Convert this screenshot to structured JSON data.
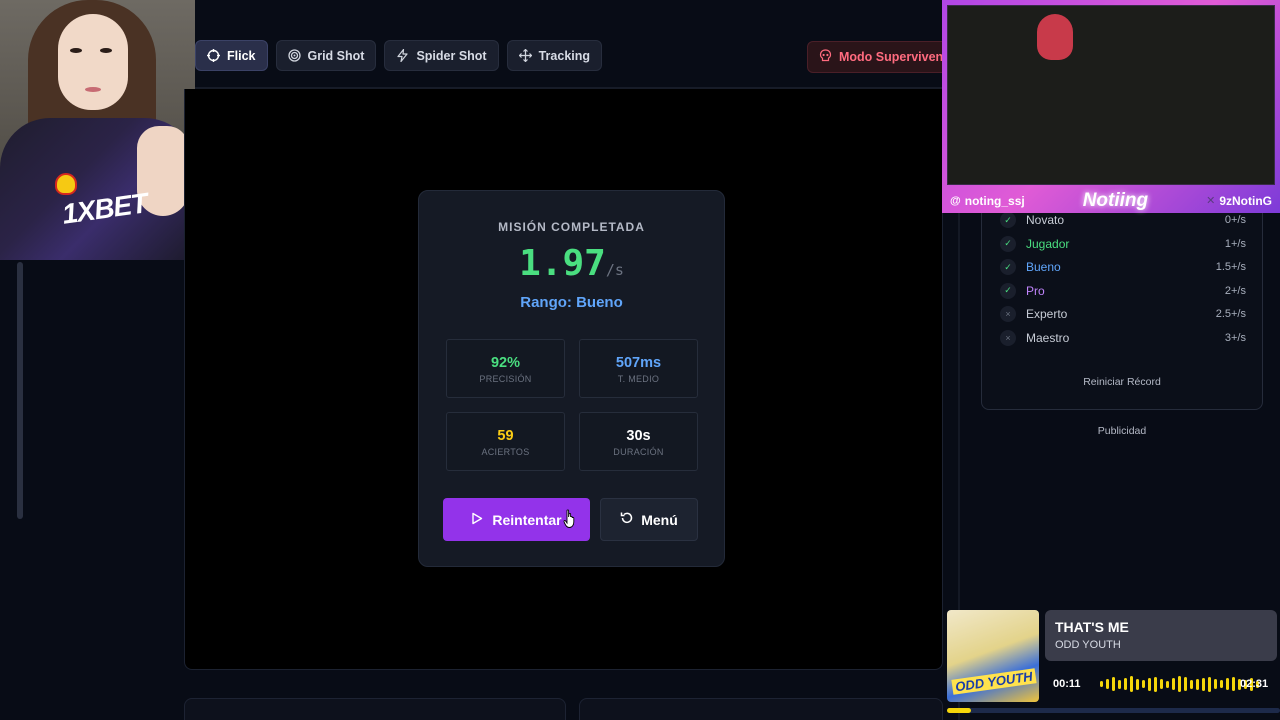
{
  "tabs": [
    {
      "label": "Flick",
      "icon": "crosshair-icon",
      "active": true
    },
    {
      "label": "Grid Shot",
      "icon": "target-icon",
      "active": false
    },
    {
      "label": "Spider Shot",
      "icon": "bolt-icon",
      "active": false
    },
    {
      "label": "Tracking",
      "icon": "move-icon",
      "active": false
    }
  ],
  "survival_mode": {
    "label": "Modo Supervivencia",
    "icon": "skull-icon"
  },
  "result": {
    "heading": "MISIÓN COMPLETADA",
    "score": "1.97",
    "score_unit": "/s",
    "rank": "Rango: Bueno",
    "stats": [
      {
        "value": "92%",
        "label": "PRECISIÓN",
        "color": "#4ade80"
      },
      {
        "value": "507ms",
        "label": "T. MEDIO",
        "color": "#60a5fa"
      },
      {
        "value": "59",
        "label": "ACIERTOS",
        "color": "#facc15"
      },
      {
        "value": "30s",
        "label": "DURACIÓN",
        "color": "#ffffff"
      }
    ],
    "retry_label": "Reintentar",
    "menu_label": "Menú"
  },
  "ranks": {
    "items": [
      {
        "name": "Novato",
        "rate": "0+/s",
        "achieved": true,
        "color": "#c7ccd6"
      },
      {
        "name": "Jugador",
        "rate": "1+/s",
        "achieved": true,
        "color": "#4ade80"
      },
      {
        "name": "Bueno",
        "rate": "1.5+/s",
        "achieved": true,
        "color": "#60a5fa"
      },
      {
        "name": "Pro",
        "rate": "2+/s",
        "achieved": true,
        "color": "#c084fc"
      },
      {
        "name": "Experto",
        "rate": "2.5+/s",
        "achieved": false,
        "color": "#c7ccd6"
      },
      {
        "name": "Maestro",
        "rate": "3+/s",
        "achieved": false,
        "color": "#c7ccd6"
      }
    ],
    "reset_label": "Reiniciar Récord"
  },
  "ads_label": "Publicidad",
  "webcam": {
    "sponsor": "1XBET"
  },
  "stream_overlay": {
    "handle_left": "noting_ssj",
    "brand": "Notiing",
    "handle_right": "9zNotinG"
  },
  "now_playing": {
    "title": "THAT'S ME",
    "artist": "ODD YOUTH",
    "current_time": "00:11",
    "total_time": "02:31",
    "progress": 0.073,
    "album_label": "ODD YOUTH"
  }
}
